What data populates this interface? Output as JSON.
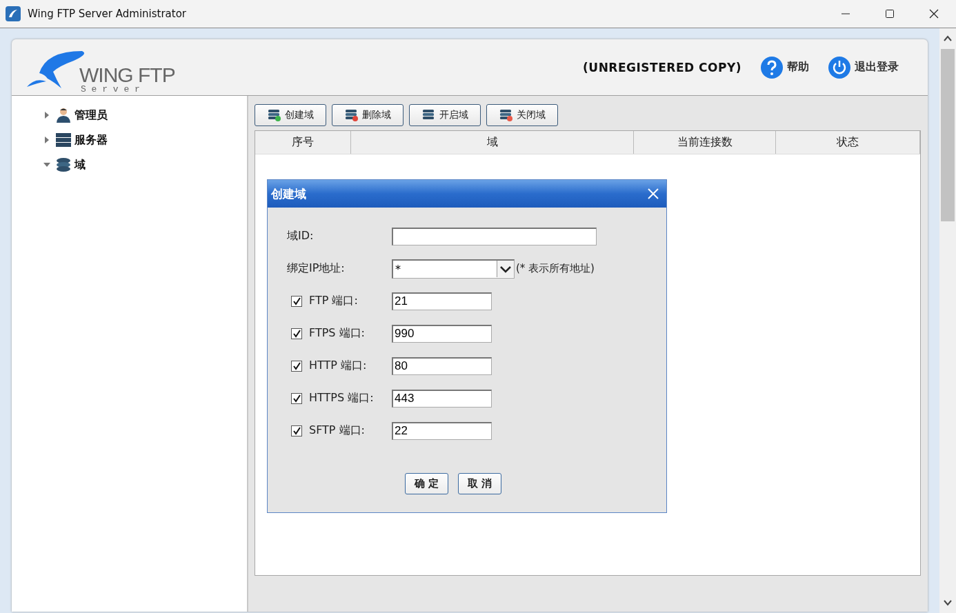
{
  "window": {
    "title": "Wing FTP Server Administrator"
  },
  "header": {
    "logo_name": "WING FTP",
    "logo_sub": "S e r v e r",
    "notice": "(UNREGISTERED COPY)",
    "help": "帮助",
    "logout": "退出登录"
  },
  "tree": [
    {
      "label": "管理员",
      "expanded": false
    },
    {
      "label": "服务器",
      "expanded": false
    },
    {
      "label": "域",
      "expanded": true
    }
  ],
  "toolbar": [
    {
      "label": "创建域",
      "kind": "add"
    },
    {
      "label": "删除域",
      "kind": "delete"
    },
    {
      "label": "开启域",
      "kind": "start"
    },
    {
      "label": "关闭域",
      "kind": "stop"
    }
  ],
  "table": {
    "columns": [
      "序号",
      "域",
      "当前连接数",
      "状态"
    ]
  },
  "dialog": {
    "title": "创建域",
    "id_label": "域ID:",
    "ip_label": "绑定IP地址:",
    "ip_value": "*",
    "ip_hint": "(* 表示所有地址)",
    "ports": [
      {
        "label": "FTP 端口:",
        "value": "21",
        "checked": true
      },
      {
        "label": "FTPS 端口:",
        "value": "990",
        "checked": true
      },
      {
        "label": "HTTP 端口:",
        "value": "80",
        "checked": true
      },
      {
        "label": "HTTPS 端口:",
        "value": "443",
        "checked": true
      },
      {
        "label": "SFTP 端口:",
        "value": "22",
        "checked": true
      }
    ],
    "buttons": [
      "确 定",
      "取 消"
    ]
  }
}
